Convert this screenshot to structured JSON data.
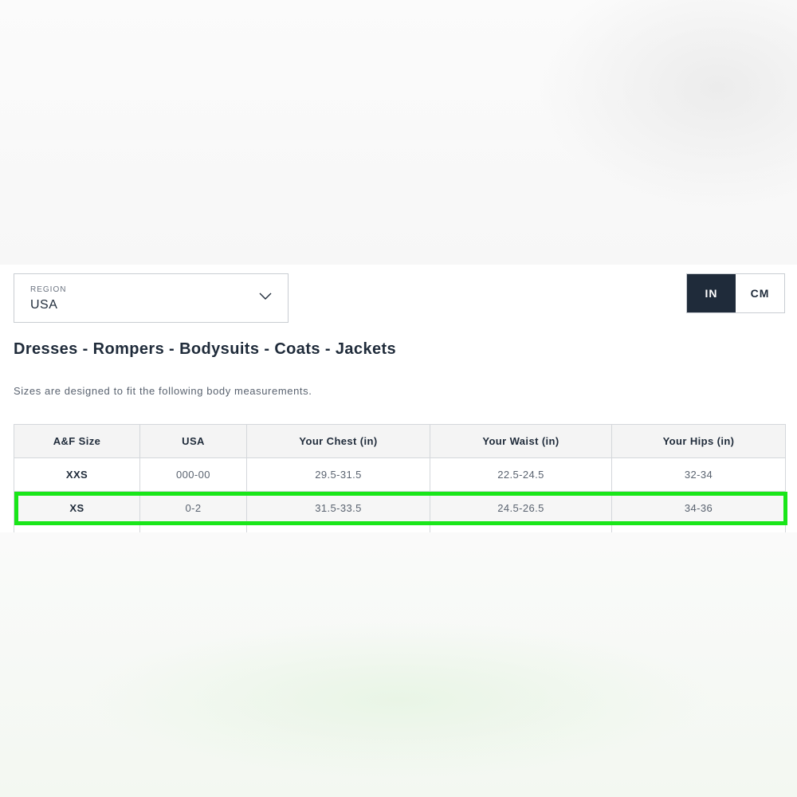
{
  "region": {
    "label": "REGION",
    "value": "USA"
  },
  "units": {
    "options": [
      "IN",
      "CM"
    ],
    "selected": "IN"
  },
  "heading": "Dresses - Rompers - Bodysuits - Coats - Jackets",
  "subtext": "Sizes are designed to fit the following body measurements.",
  "table": {
    "headers": [
      "A&F Size",
      "USA",
      "Your Chest (in)",
      "Your Waist (in)",
      "Your Hips (in)"
    ],
    "rows": [
      [
        "XXS",
        "000-00",
        "29.5-31.5",
        "22.5-24.5",
        "32-34"
      ],
      [
        "XS",
        "0-2",
        "31.5-33.5",
        "24.5-26.5",
        "34-36"
      ]
    ],
    "highlighted_row": "XS"
  },
  "colors": {
    "accent_dark": "#1f2b3a",
    "highlight": "#19e619"
  },
  "icons": {
    "region_dropdown": "chevron-down-icon"
  }
}
